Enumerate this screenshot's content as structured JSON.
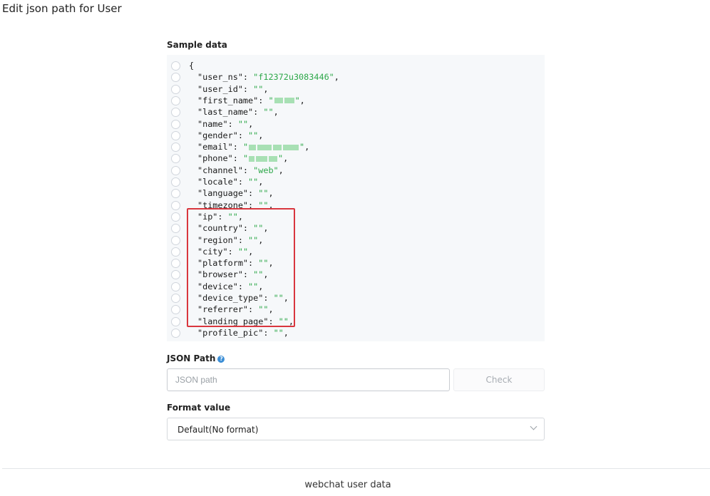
{
  "page": {
    "title": "Edit json path for User"
  },
  "sample_data": {
    "label": "Sample data",
    "open_brace": "{",
    "lines": [
      {
        "key": "\"user_ns\"",
        "value": "\"f12372u3083446\"",
        "redacted": false
      },
      {
        "key": "\"user_id\"",
        "value": "\"\"",
        "redacted": false
      },
      {
        "key": "\"first_name\"",
        "value": "",
        "redacted": true
      },
      {
        "key": "\"last_name\"",
        "value": "\"\"",
        "redacted": false
      },
      {
        "key": "\"name\"",
        "value": "\"\"",
        "redacted": false
      },
      {
        "key": "\"gender\"",
        "value": "\"\"",
        "redacted": false
      },
      {
        "key": "\"email\"",
        "value": "",
        "redacted": true
      },
      {
        "key": "\"phone\"",
        "value": "",
        "redacted": true
      },
      {
        "key": "\"channel\"",
        "value": "\"web\"",
        "redacted": false
      },
      {
        "key": "\"locale\"",
        "value": "\"\"",
        "redacted": false
      },
      {
        "key": "\"language\"",
        "value": "\"\"",
        "redacted": false
      },
      {
        "key": "\"timezone\"",
        "value": "\"\"",
        "redacted": false
      },
      {
        "key": "\"ip\"",
        "value": "\"\"",
        "redacted": false
      },
      {
        "key": "\"country\"",
        "value": "\"\"",
        "redacted": false
      },
      {
        "key": "\"region\"",
        "value": "\"\"",
        "redacted": false
      },
      {
        "key": "\"city\"",
        "value": "\"\"",
        "redacted": false
      },
      {
        "key": "\"platform\"",
        "value": "\"\"",
        "redacted": false
      },
      {
        "key": "\"browser\"",
        "value": "\"\"",
        "redacted": false
      },
      {
        "key": "\"device\"",
        "value": "\"\"",
        "redacted": false
      },
      {
        "key": "\"device_type\"",
        "value": "\"\"",
        "redacted": false
      },
      {
        "key": "\"referrer\"",
        "value": "\"\"",
        "redacted": false
      },
      {
        "key": "\"landing_page\"",
        "value": "\"\"",
        "redacted": false
      },
      {
        "key": "\"profile_pic\"",
        "value": "\"\"",
        "redacted": false
      }
    ]
  },
  "json_path": {
    "label": "JSON Path",
    "help_icon": "question-circle-icon",
    "placeholder": "JSON path",
    "value": "",
    "check_label": "Check"
  },
  "format_value": {
    "label": "Format value",
    "selected": "Default(No format)"
  },
  "footer": {
    "label": "webchat user data"
  },
  "colors": {
    "string_value": "#2ea84a",
    "highlight": "#d9363e",
    "help": "#3d8fd6"
  }
}
